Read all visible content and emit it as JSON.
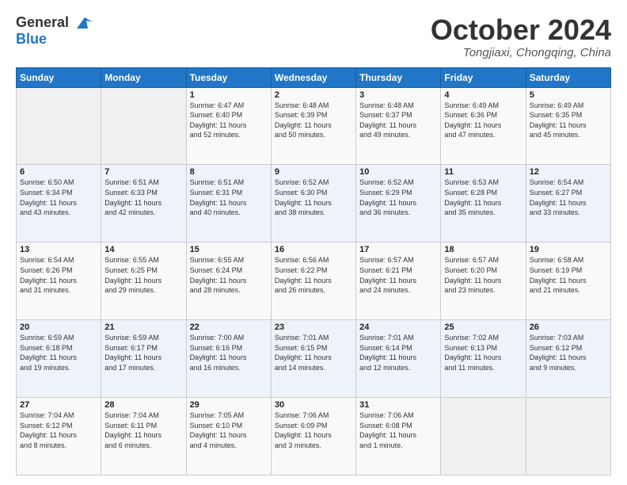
{
  "header": {
    "logo_line1": "General",
    "logo_line2": "Blue",
    "month": "October 2024",
    "location": "Tongjiaxi, Chongqing, China"
  },
  "weekdays": [
    "Sunday",
    "Monday",
    "Tuesday",
    "Wednesday",
    "Thursday",
    "Friday",
    "Saturday"
  ],
  "weeks": [
    [
      {
        "day": "",
        "info": ""
      },
      {
        "day": "",
        "info": ""
      },
      {
        "day": "1",
        "info": "Sunrise: 6:47 AM\nSunset: 6:40 PM\nDaylight: 11 hours\nand 52 minutes."
      },
      {
        "day": "2",
        "info": "Sunrise: 6:48 AM\nSunset: 6:39 PM\nDaylight: 11 hours\nand 50 minutes."
      },
      {
        "day": "3",
        "info": "Sunrise: 6:48 AM\nSunset: 6:37 PM\nDaylight: 11 hours\nand 49 minutes."
      },
      {
        "day": "4",
        "info": "Sunrise: 6:49 AM\nSunset: 6:36 PM\nDaylight: 11 hours\nand 47 minutes."
      },
      {
        "day": "5",
        "info": "Sunrise: 6:49 AM\nSunset: 6:35 PM\nDaylight: 11 hours\nand 45 minutes."
      }
    ],
    [
      {
        "day": "6",
        "info": "Sunrise: 6:50 AM\nSunset: 6:34 PM\nDaylight: 11 hours\nand 43 minutes."
      },
      {
        "day": "7",
        "info": "Sunrise: 6:51 AM\nSunset: 6:33 PM\nDaylight: 11 hours\nand 42 minutes."
      },
      {
        "day": "8",
        "info": "Sunrise: 6:51 AM\nSunset: 6:31 PM\nDaylight: 11 hours\nand 40 minutes."
      },
      {
        "day": "9",
        "info": "Sunrise: 6:52 AM\nSunset: 6:30 PM\nDaylight: 11 hours\nand 38 minutes."
      },
      {
        "day": "10",
        "info": "Sunrise: 6:52 AM\nSunset: 6:29 PM\nDaylight: 11 hours\nand 36 minutes."
      },
      {
        "day": "11",
        "info": "Sunrise: 6:53 AM\nSunset: 6:28 PM\nDaylight: 11 hours\nand 35 minutes."
      },
      {
        "day": "12",
        "info": "Sunrise: 6:54 AM\nSunset: 6:27 PM\nDaylight: 11 hours\nand 33 minutes."
      }
    ],
    [
      {
        "day": "13",
        "info": "Sunrise: 6:54 AM\nSunset: 6:26 PM\nDaylight: 11 hours\nand 31 minutes."
      },
      {
        "day": "14",
        "info": "Sunrise: 6:55 AM\nSunset: 6:25 PM\nDaylight: 11 hours\nand 29 minutes."
      },
      {
        "day": "15",
        "info": "Sunrise: 6:55 AM\nSunset: 6:24 PM\nDaylight: 11 hours\nand 28 minutes."
      },
      {
        "day": "16",
        "info": "Sunrise: 6:56 AM\nSunset: 6:22 PM\nDaylight: 11 hours\nand 26 minutes."
      },
      {
        "day": "17",
        "info": "Sunrise: 6:57 AM\nSunset: 6:21 PM\nDaylight: 11 hours\nand 24 minutes."
      },
      {
        "day": "18",
        "info": "Sunrise: 6:57 AM\nSunset: 6:20 PM\nDaylight: 11 hours\nand 23 minutes."
      },
      {
        "day": "19",
        "info": "Sunrise: 6:58 AM\nSunset: 6:19 PM\nDaylight: 11 hours\nand 21 minutes."
      }
    ],
    [
      {
        "day": "20",
        "info": "Sunrise: 6:59 AM\nSunset: 6:18 PM\nDaylight: 11 hours\nand 19 minutes."
      },
      {
        "day": "21",
        "info": "Sunrise: 6:59 AM\nSunset: 6:17 PM\nDaylight: 11 hours\nand 17 minutes."
      },
      {
        "day": "22",
        "info": "Sunrise: 7:00 AM\nSunset: 6:16 PM\nDaylight: 11 hours\nand 16 minutes."
      },
      {
        "day": "23",
        "info": "Sunrise: 7:01 AM\nSunset: 6:15 PM\nDaylight: 11 hours\nand 14 minutes."
      },
      {
        "day": "24",
        "info": "Sunrise: 7:01 AM\nSunset: 6:14 PM\nDaylight: 11 hours\nand 12 minutes."
      },
      {
        "day": "25",
        "info": "Sunrise: 7:02 AM\nSunset: 6:13 PM\nDaylight: 11 hours\nand 11 minutes."
      },
      {
        "day": "26",
        "info": "Sunrise: 7:03 AM\nSunset: 6:12 PM\nDaylight: 11 hours\nand 9 minutes."
      }
    ],
    [
      {
        "day": "27",
        "info": "Sunrise: 7:04 AM\nSunset: 6:12 PM\nDaylight: 11 hours\nand 8 minutes."
      },
      {
        "day": "28",
        "info": "Sunrise: 7:04 AM\nSunset: 6:11 PM\nDaylight: 11 hours\nand 6 minutes."
      },
      {
        "day": "29",
        "info": "Sunrise: 7:05 AM\nSunset: 6:10 PM\nDaylight: 11 hours\nand 4 minutes."
      },
      {
        "day": "30",
        "info": "Sunrise: 7:06 AM\nSunset: 6:09 PM\nDaylight: 11 hours\nand 3 minutes."
      },
      {
        "day": "31",
        "info": "Sunrise: 7:06 AM\nSunset: 6:08 PM\nDaylight: 11 hours\nand 1 minute."
      },
      {
        "day": "",
        "info": ""
      },
      {
        "day": "",
        "info": ""
      }
    ]
  ]
}
